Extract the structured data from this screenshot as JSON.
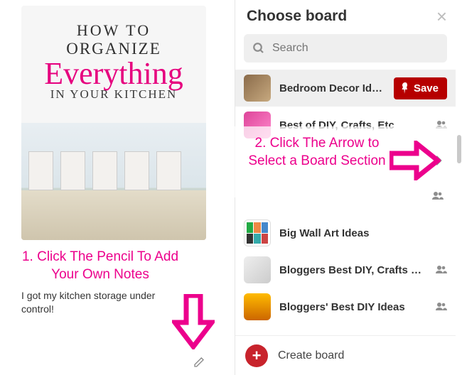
{
  "pin": {
    "graphic": {
      "line1": "HOW TO",
      "line2": "ORGANIZE",
      "line3": "Everything",
      "line4": "IN YOUR KITCHEN"
    },
    "note": "I got my kitchen storage under control!"
  },
  "annotations": {
    "step1": "1. Click The Pencil To Add Your Own Notes",
    "step2": "2. Click The Arrow to Select a Board Section"
  },
  "panel": {
    "title": "Choose board",
    "search_placeholder": "Search",
    "save_label": "Save",
    "create_label": "Create board",
    "boards": [
      {
        "name": "Bedroom Decor Id…",
        "collab": false,
        "highlight": true
      },
      {
        "name": "Best of DIY, Crafts, Etc",
        "collab": true,
        "highlight": false
      },
      {
        "name": "",
        "collab": true,
        "highlight": false
      },
      {
        "name": "Big Wall Art Ideas",
        "collab": false,
        "highlight": false
      },
      {
        "name": "Bloggers Best DIY, Crafts …",
        "collab": true,
        "highlight": false
      },
      {
        "name": "Bloggers' Best DIY Ideas",
        "collab": true,
        "highlight": false
      }
    ]
  },
  "icons": {
    "pencil": "pencil-icon",
    "close": "close-icon",
    "search": "search-icon",
    "collab": "group-icon",
    "pin": "pin-icon",
    "plus": "plus-icon",
    "chevron": "chevron-right-icon"
  },
  "colors": {
    "accent_pink": "#ec008c",
    "save_red": "#b60000",
    "create_red": "#c8232c"
  }
}
